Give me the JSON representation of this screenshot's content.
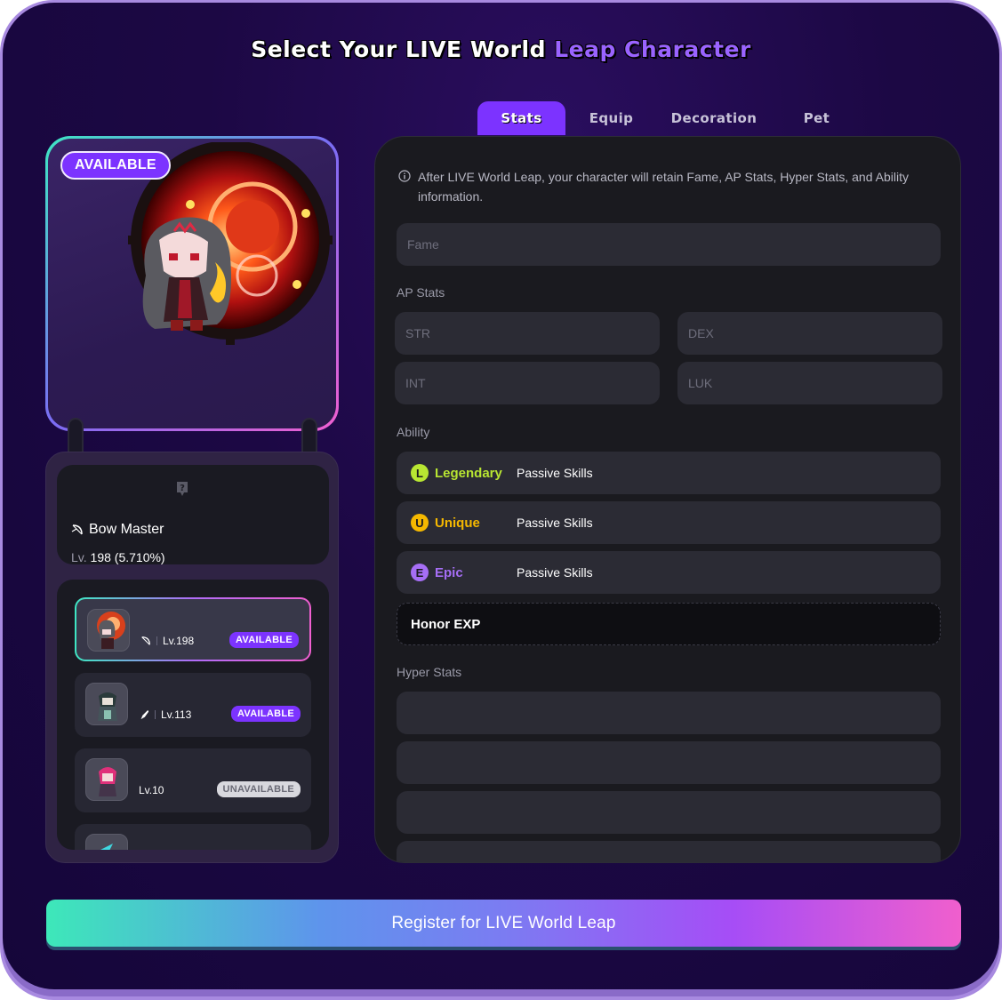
{
  "title": {
    "main": "Select Your LIVE World ",
    "accent": "Leap Character"
  },
  "character_card": {
    "status": "AVAILABLE"
  },
  "info": {
    "job": "Bow Master",
    "level_label": "Lv.",
    "level_value": "198 (5.710%)"
  },
  "character_list": [
    {
      "level": "Lv.198",
      "badge": "AVAILABLE",
      "available": true,
      "selected": true
    },
    {
      "level": "Lv.113",
      "badge": "AVAILABLE",
      "available": true,
      "selected": false
    },
    {
      "level": "Lv.10",
      "badge": "UNAVAILABLE",
      "available": false,
      "selected": false
    }
  ],
  "tabs": [
    "Stats",
    "Equip",
    "Decoration",
    "Pet"
  ],
  "active_tab": "Stats",
  "stats": {
    "notice": "After LIVE World Leap, your character will retain Fame, AP Stats, Hyper Stats, and Ability information.",
    "fame_placeholder": "Fame",
    "ap_label": "AP Stats",
    "ap_fields": [
      "STR",
      "DEX",
      "INT",
      "LUK"
    ],
    "ability_label": "Ability",
    "abilities": [
      {
        "letter": "L",
        "grade": "Legendary",
        "desc": "Passive Skills",
        "color": "#b8e632"
      },
      {
        "letter": "U",
        "grade": "Unique",
        "desc": "Passive Skills",
        "color": "#f5b800"
      },
      {
        "letter": "E",
        "grade": "Epic",
        "desc": "Passive Skills",
        "color": "#a66ef5"
      }
    ],
    "honor_label": "Honor EXP",
    "hyper_label": "Hyper Stats"
  },
  "register_button": "Register for LIVE World Leap",
  "colors": {
    "accent": "#7c33ff",
    "panel": "#1a1a1f",
    "field": "#2b2b34"
  }
}
